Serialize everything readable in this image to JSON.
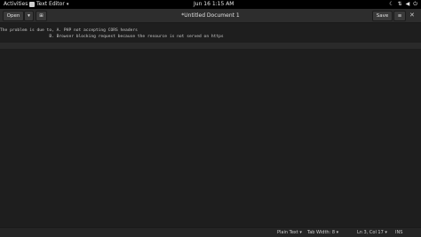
{
  "topbar": {
    "activities": "Activities",
    "app_name": "Text Editor",
    "clock": "Jun 16  1:15 AM",
    "icons": [
      "moon-icon",
      "network-icon",
      "volume-icon",
      "power-icon"
    ]
  },
  "header": {
    "open_label": "Open",
    "save_label": "Save",
    "title": "*Untitled Document 1"
  },
  "editor": {
    "lines": [
      "The problem is due to, A. PHP not accepting CORS headers",
      "                    B. Browser blocking request because the resource is not served on https",
      ""
    ]
  },
  "status": {
    "language": "Plain Text ▾",
    "tab_width": "Tab Width: 8 ▾",
    "position": "Ln 3, Col 17 ▾",
    "mode": "INS"
  },
  "colors": {
    "background": "#1e1e1e",
    "header": "#2d2d2d",
    "topbar": "#000000"
  }
}
